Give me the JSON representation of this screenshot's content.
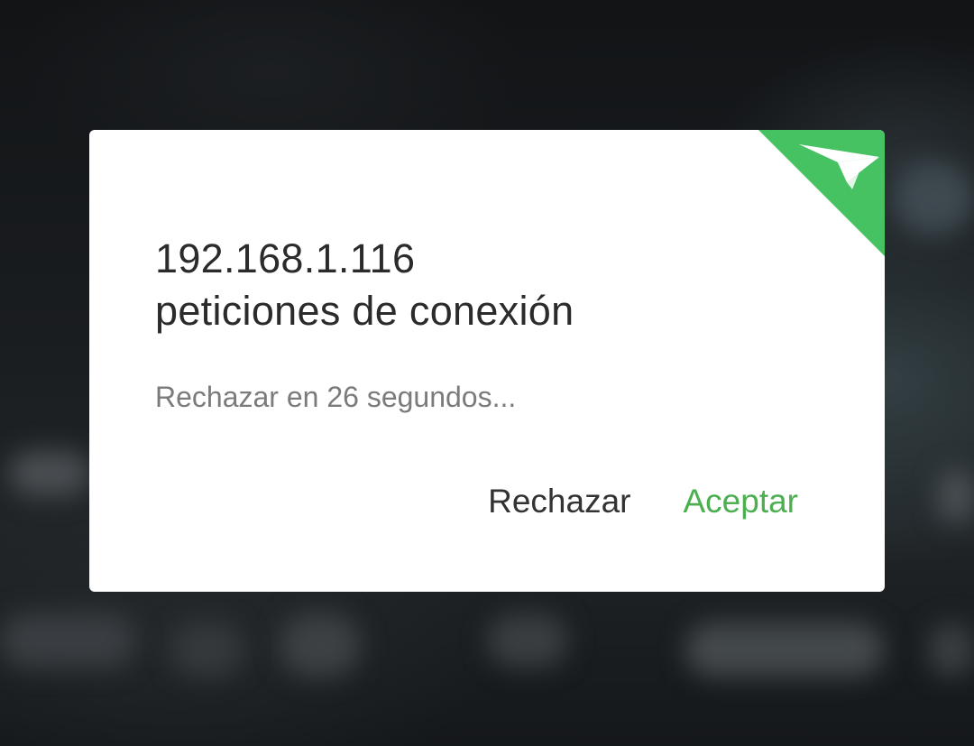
{
  "dialog": {
    "title_line1": "192.168.1.116",
    "title_line2": "peticiones de conexión",
    "countdown_text": "Rechazar en 26 segundos...",
    "reject_label": "Rechazar",
    "accept_label": "Aceptar",
    "corner_icon": "paper-plane-icon"
  },
  "colors": {
    "accent": "#47c263",
    "accept_text": "#4caf50",
    "reject_text": "#333333",
    "countdown_text": "#7b7b7b"
  }
}
